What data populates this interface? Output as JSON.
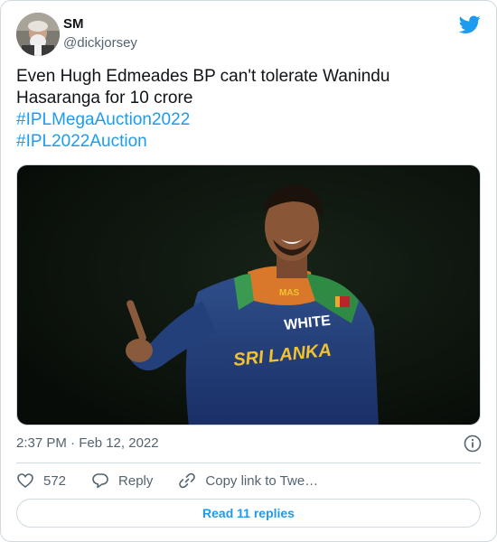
{
  "author": {
    "name": "SM",
    "handle": "@dickjorsey"
  },
  "tweet": {
    "text_line1": "Even Hugh Edmeades BP can't tolerate Wanindu",
    "text_line2": "Hasaranga for 10 crore",
    "hashtags": [
      "#IPLMegaAuction2022",
      "#IPL2022Auction"
    ]
  },
  "media": {
    "jersey_logo": "WHITE",
    "jersey_team": "SRI LANKA",
    "jersey_sponsor": "MAS"
  },
  "meta": {
    "timestamp": "2:37 PM · Feb 12, 2022"
  },
  "actions": {
    "likes": "572",
    "reply_label": "Reply",
    "copy_label": "Copy link to Twe…"
  },
  "read_replies": "Read 11 replies",
  "colors": {
    "accent": "#1d9bf0",
    "muted": "#536471",
    "border": "#cfd9de"
  },
  "icons": [
    "twitter-bird-icon",
    "info-icon",
    "heart-icon",
    "reply-icon",
    "link-icon"
  ]
}
